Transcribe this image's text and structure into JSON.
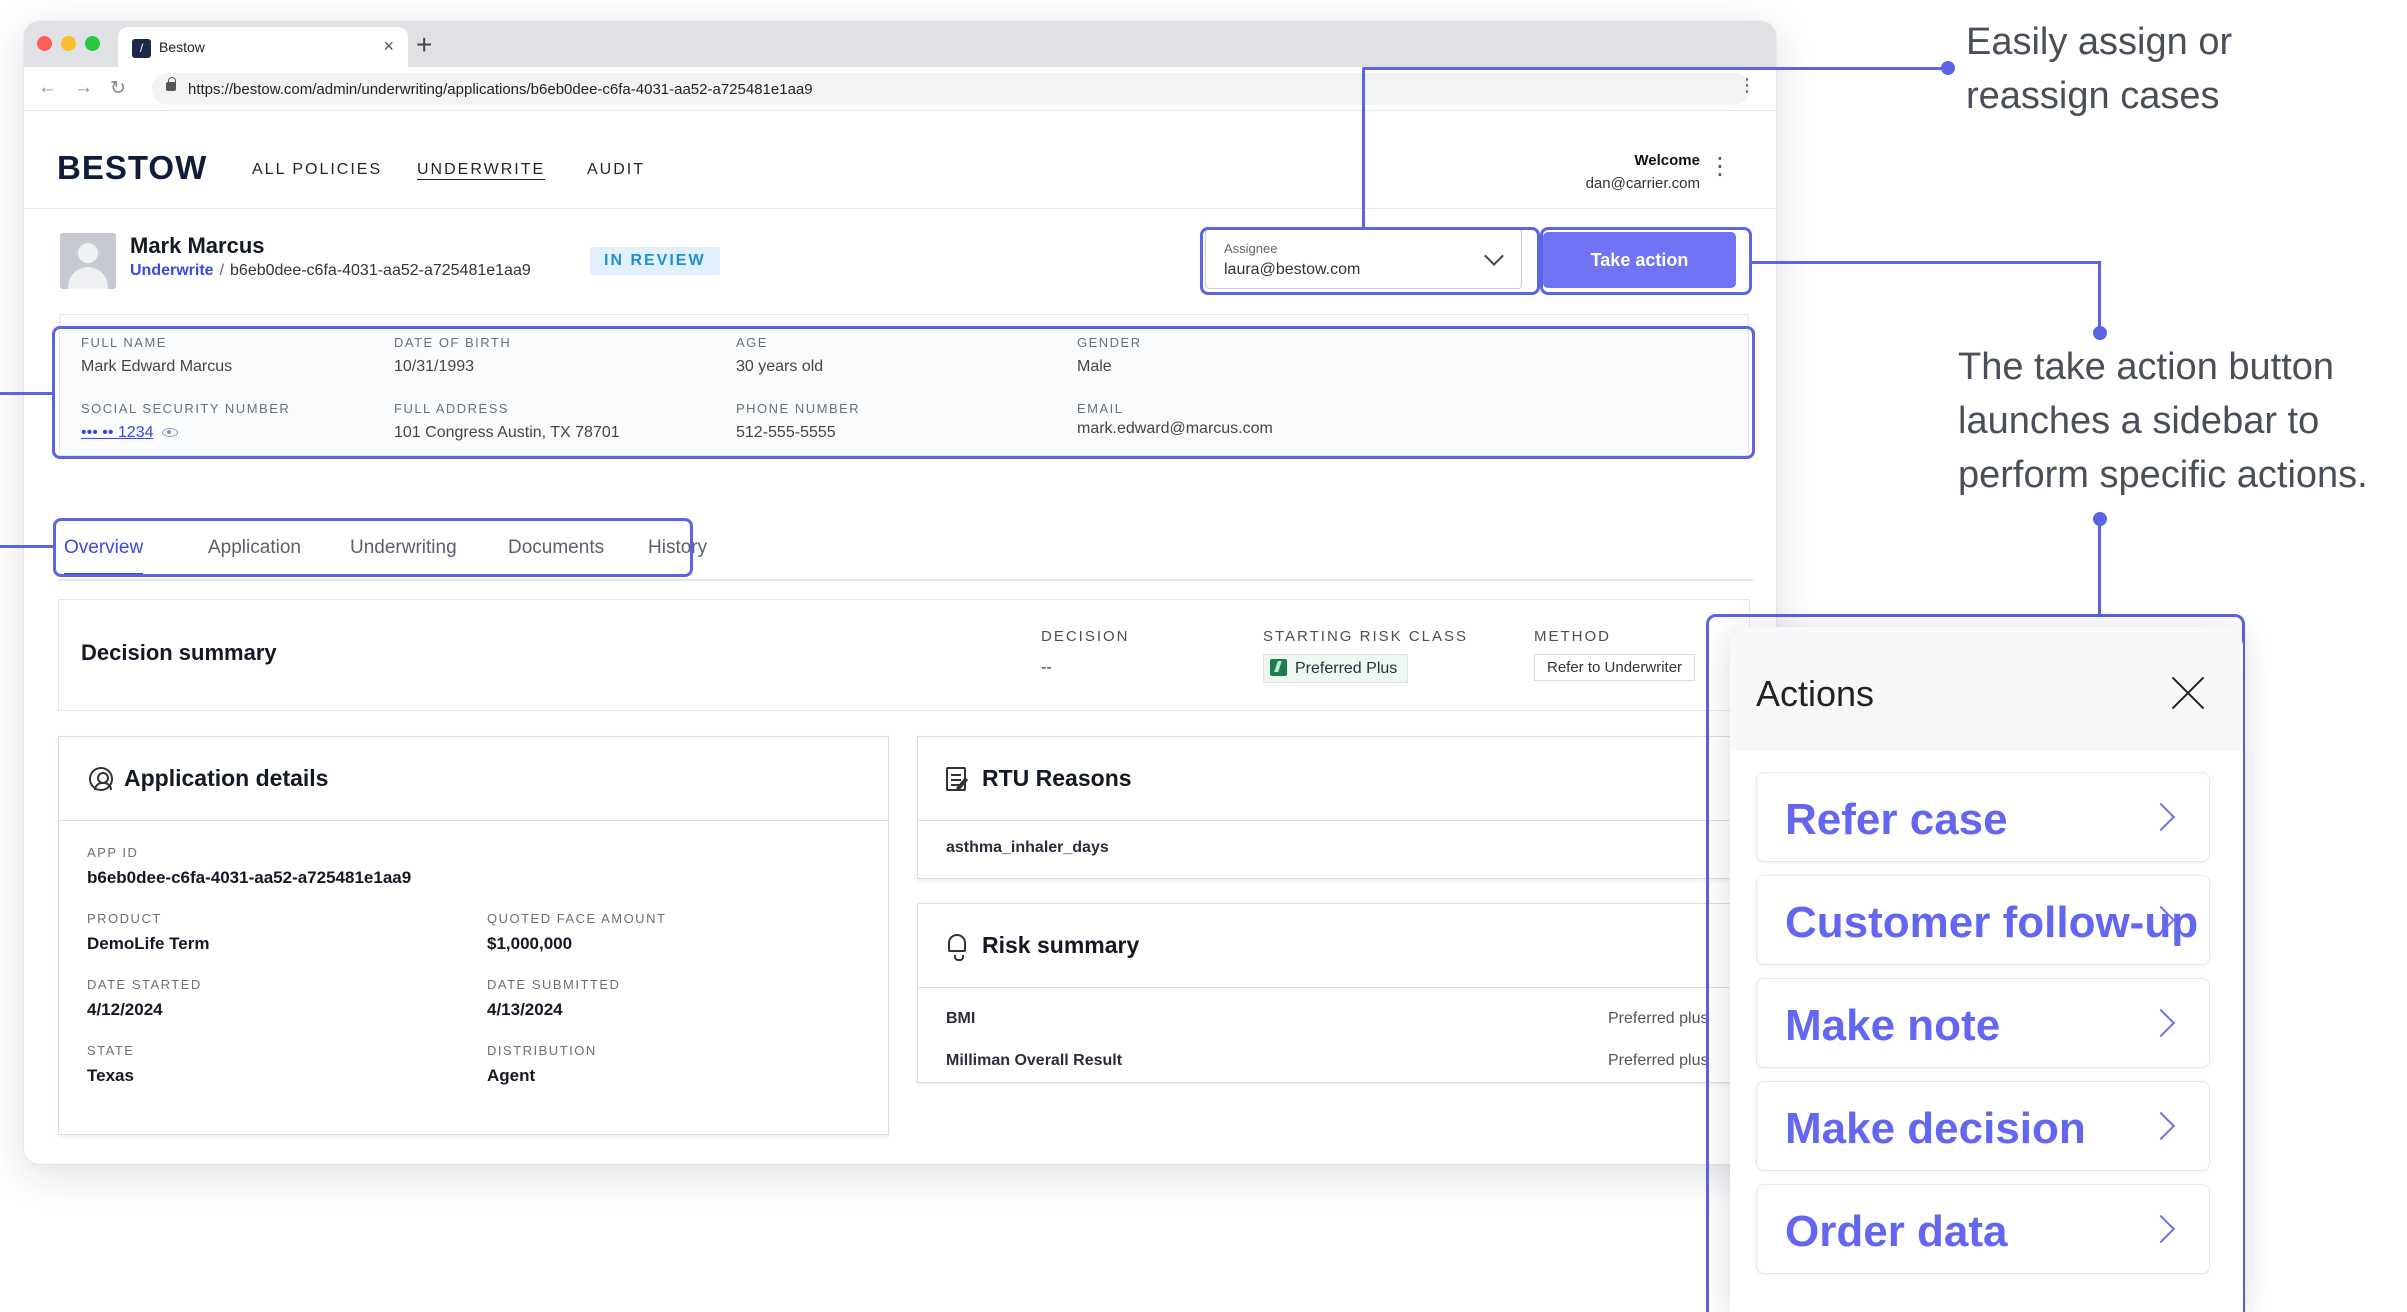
{
  "browser": {
    "tab_title": "Bestow",
    "url": "https://bestow.com/admin/underwriting/applications/b6eb0dee-c6fa-4031-aa52-a725481e1aa9"
  },
  "app": {
    "logo": "BESTOW",
    "nav": [
      "ALL POLICIES",
      "UNDERWRITE",
      "AUDIT"
    ],
    "active_nav": "UNDERWRITE",
    "welcome_label": "Welcome",
    "user_email": "dan@carrier.com"
  },
  "case": {
    "name": "Mark Marcus",
    "breadcrumb_link": "Underwrite",
    "breadcrumb_sep": "/",
    "case_id": "b6eb0dee-c6fa-4031-aa52-a725481e1aa9",
    "status": "IN REVIEW",
    "assignee_label": "Assignee",
    "assignee_value": "laura@bestow.com",
    "take_action_label": "Take action"
  },
  "info": [
    {
      "label": "FULL NAME",
      "value": "Mark Edward Marcus"
    },
    {
      "label": "DATE OF BIRTH",
      "value": "10/31/1993"
    },
    {
      "label": "AGE",
      "value": "30 years old"
    },
    {
      "label": "GENDER",
      "value": "Male"
    },
    {
      "label": "SOCIAL SECURITY NUMBER",
      "value": "••• •• 1234"
    },
    {
      "label": "FULL ADDRESS",
      "value": "101 Congress Austin, TX 78701"
    },
    {
      "label": "PHONE NUMBER",
      "value": "512-555-5555"
    },
    {
      "label": "EMAIL",
      "value": "mark.edward@marcus.com"
    }
  ],
  "tabs": [
    "Overview",
    "Application",
    "Underwriting",
    "Documents",
    "History"
  ],
  "decision_summary": {
    "title": "Decision summary",
    "decision_label": "DECISION",
    "decision_value": "--",
    "risk_label": "STARTING RISK CLASS",
    "risk_value": "Preferred Plus",
    "method_label": "METHOD",
    "method_value": "Refer to Underwriter"
  },
  "application_details": {
    "title": "Application details",
    "app_id_label": "APP ID",
    "app_id": "b6eb0dee-c6fa-4031-aa52-a725481e1aa9",
    "fields": [
      {
        "label": "PRODUCT",
        "value": "DemoLife Term"
      },
      {
        "label": "QUOTED FACE AMOUNT",
        "value": "$1,000,000"
      },
      {
        "label": "DATE STARTED",
        "value": "4/12/2024"
      },
      {
        "label": "DATE SUBMITTED",
        "value": "4/13/2024"
      },
      {
        "label": "STATE",
        "value": "Texas"
      },
      {
        "label": "DISTRIBUTION",
        "value": "Agent"
      }
    ]
  },
  "rtu_reasons": {
    "title": "RTU Reasons",
    "items": [
      "asthma_inhaler_days"
    ]
  },
  "risk_summary": {
    "title": "Risk summary",
    "rows": [
      {
        "label": "BMI",
        "value": "Preferred plus"
      },
      {
        "label": "Milliman Overall Result",
        "value": "Preferred plus"
      }
    ]
  },
  "actions_panel": {
    "title": "Actions",
    "items": [
      "Refer case",
      "Customer follow-up",
      "Make note",
      "Make decision",
      "Order data"
    ]
  },
  "annotations": {
    "assign": "Easily assign or reassign cases",
    "take_action": "The take action button launches a sidebar to perform specific actions."
  },
  "colors": {
    "accent": "#6f73f4",
    "link": "#3b49df",
    "annotation": "#5b63e6",
    "status_bg": "#e1f0fb",
    "status_text": "#1f8fd6"
  }
}
